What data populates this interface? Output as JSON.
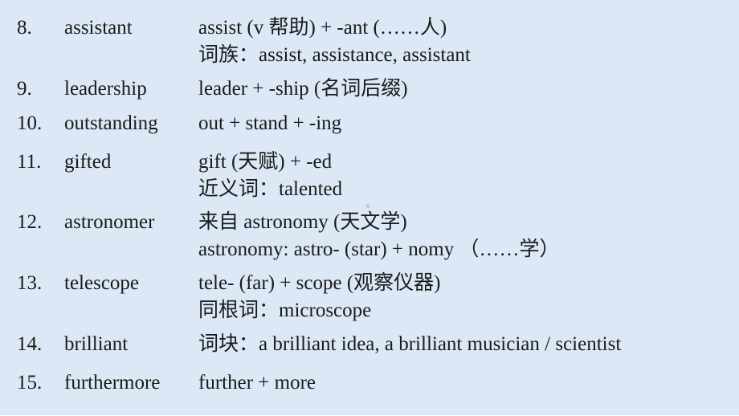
{
  "entries": [
    {
      "num": "8.",
      "word": "assistant",
      "lines": [
        "assist (v 帮助) + -ant (……人)",
        "词族：assist, assistance, assistant"
      ]
    },
    {
      "num": "9.",
      "word": "leadership",
      "lines": [
        "leader + -ship (名词后缀)"
      ]
    },
    {
      "num": "10.",
      "word": "outstanding",
      "lines": [
        "out + stand + -ing"
      ]
    },
    {
      "num": "11.",
      "word": "gifted",
      "lines": [
        "gift (天赋) + -ed",
        "近义词：talented"
      ]
    },
    {
      "num": "12.",
      "word": "astronomer",
      "lines": [
        "来自 astronomy (天文学)",
        "astronomy: astro- (star) + nomy （……学）"
      ]
    },
    {
      "num": "13.",
      "word": "telescope",
      "lines": [
        "tele- (far) + scope (观察仪器)",
        "同根词：microscope"
      ]
    },
    {
      "num": "14.",
      "word": "brilliant",
      "lines": [
        "词块：a brilliant idea, a brilliant musician / scientist"
      ]
    },
    {
      "num": "15.",
      "word": "furthermore",
      "lines": [
        "further + more"
      ]
    }
  ]
}
